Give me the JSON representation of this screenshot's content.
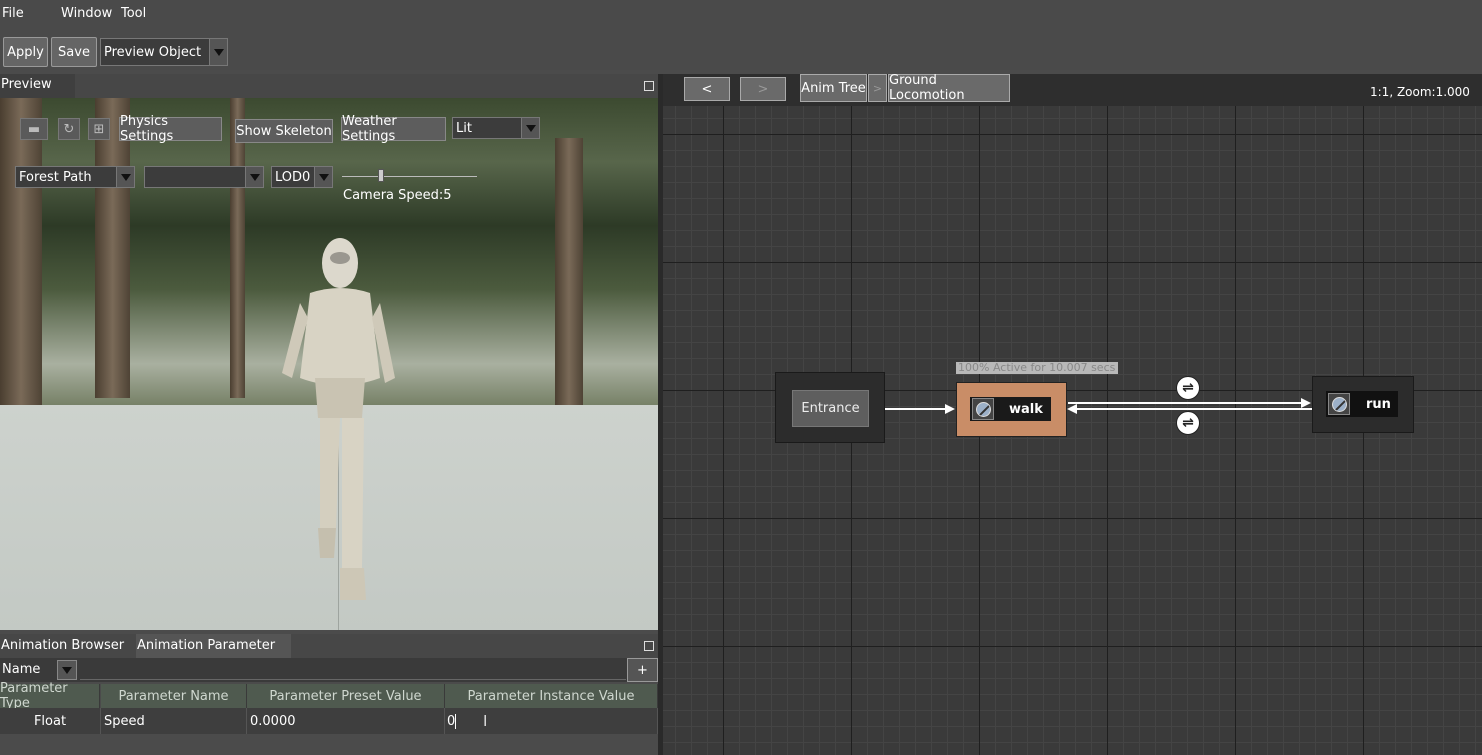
{
  "menu": {
    "file": "File",
    "window": "Window",
    "tool": "Tool"
  },
  "toolbar": {
    "apply": "Apply",
    "save": "Save",
    "preview_object": "Preview Object"
  },
  "preview": {
    "tab": "Preview",
    "physics_settings": "Physics Settings",
    "show_skeleton": "Show Skeleton",
    "weather_settings": "Weather Settings",
    "lighting_mode": "Lit",
    "environment": "Forest Path",
    "second_dropdown": "",
    "lod": "LOD0",
    "camera_speed_label": "Camera Speed:5",
    "camera_speed_value": 5
  },
  "bottom": {
    "tab_browser": "Animation Browser",
    "tab_parameter": "Animation Parameter",
    "name_label": "Name",
    "add_label": "+",
    "columns": [
      "Parameter Type",
      "Parameter Name",
      "Parameter Preset Value",
      "Parameter Instance Value"
    ],
    "rows": [
      {
        "type": "Float",
        "name": "Speed",
        "preset": "0.0000",
        "instance": "0"
      }
    ]
  },
  "graph": {
    "back": "<",
    "forward": ">",
    "crumb_anim_tree": "Anim Tree",
    "crumb_separator": ">",
    "crumb_current": "Ground Locomotion",
    "zoom_text": "1:1, Zoom:1.000",
    "entrance_label": "Entrance",
    "walk_label": "walk",
    "run_label": "run",
    "walk_status": "100% Active for 10.007 secs",
    "active_color": "#c98d67"
  }
}
